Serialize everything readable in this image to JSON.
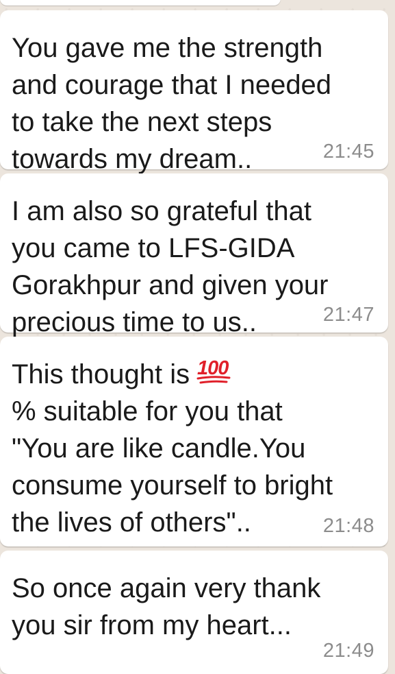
{
  "messages": [
    {
      "lines": [
        "You gave me the strength",
        "and courage that I needed",
        "to take the next steps",
        "towards my dream.."
      ],
      "time": "21:45"
    },
    {
      "lines": [
        "I am also so grateful that",
        "you came to LFS-GIDA",
        "Gorakhpur and given your",
        "precious time to us.."
      ],
      "time": "21:47"
    },
    {
      "first_line": "This thought is",
      "emoji": "hundred-points-emoji",
      "emoji_text": "100",
      "lines": [
        "% suitable for you that",
        "\"You are like candle.You",
        "consume yourself to bright",
        "the lives of others\".."
      ],
      "time": "21:48"
    },
    {
      "lines": [
        "So once again very thank",
        "you sir from my heart..."
      ],
      "time": "21:49"
    }
  ],
  "colors": {
    "wallpaper": "#ece5dd",
    "bubble": "#ffffff",
    "text": "#1a1a1a",
    "timestamp": "#8c8c8c",
    "emoji_red": "#e0202a"
  }
}
